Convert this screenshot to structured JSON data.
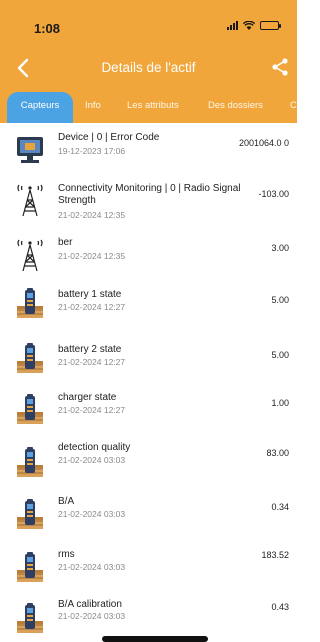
{
  "status_bar": {
    "time": "1:08"
  },
  "header": {
    "title": "Details de l'actif"
  },
  "tabs": [
    {
      "label": "Capteurs",
      "active": true
    },
    {
      "label": "Info"
    },
    {
      "label": "Les attributs"
    },
    {
      "label": "Des dossiers"
    },
    {
      "label": "C"
    }
  ],
  "sensors": [
    {
      "icon": "monitor-chip-icon",
      "title": "Device | 0 | Error Code",
      "date": "19-12-2023 17:06",
      "value": "2001064.0 0"
    },
    {
      "icon": "radio-tower-icon",
      "title": "Connectivity Monitoring | 0 | Radio Signal Strength",
      "date": "21-02-2024 12:35",
      "value": "-103.00"
    },
    {
      "icon": "radio-tower-icon",
      "title": "ber",
      "date": "21-02-2024 12:35",
      "value": "3.00"
    },
    {
      "icon": "device-box-icon",
      "title": "battery 1 state",
      "date": "21-02-2024 12:27",
      "value": "5.00"
    },
    {
      "icon": "device-box-icon",
      "title": "battery 2 state",
      "date": "21-02-2024 12:27",
      "value": "5.00"
    },
    {
      "icon": "device-box-icon",
      "title": "charger state",
      "date": "21-02-2024 12:27",
      "value": "1.00"
    },
    {
      "icon": "device-box-icon",
      "title": "detection quality",
      "date": "21-02-2024 03:03",
      "value": "83.00"
    },
    {
      "icon": "device-box-icon",
      "title": "B/A",
      "date": "21-02-2024 03:03",
      "value": "0.34"
    },
    {
      "icon": "device-box-icon",
      "title": "rms",
      "date": "21-02-2024 03:03",
      "value": "183.52"
    },
    {
      "icon": "device-box-icon",
      "title": "B/A calibration",
      "date": "21-02-2024 03:03",
      "value": "0.43"
    }
  ],
  "colors": {
    "header": "#f0a63a",
    "active_tab": "#4ba3e3"
  }
}
